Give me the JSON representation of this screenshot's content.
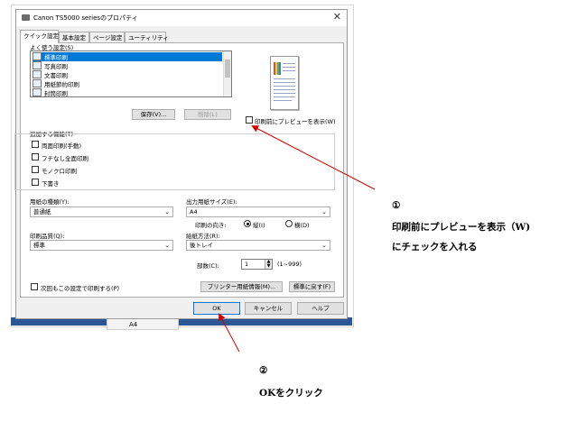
{
  "window": {
    "title": "Canon TS5000 seriesのプロパティ",
    "close_glyph": "✕"
  },
  "tabs": [
    "クイック設定",
    "基本設定",
    "ページ設定",
    "ユーティリティ"
  ],
  "favorites": {
    "label": "よく使う設定(S)",
    "items": [
      "標準印刷",
      "写真印刷",
      "文書印刷",
      "用紙節約印刷",
      "封筒印刷"
    ],
    "save_button": "保存(V)...",
    "delete_button": "削除(L)"
  },
  "preview_option": {
    "label": "印刷前にプレビューを表示(W)",
    "checked": false
  },
  "additional": {
    "label": "追加する機能(T)",
    "items": [
      "両面印刷(手動)",
      "フチなし全面印刷",
      "モノクロ印刷",
      "下書き"
    ]
  },
  "media_type": {
    "label": "用紙の種類(Y):",
    "value": "普通紙"
  },
  "print_quality": {
    "label": "印刷品質(Q):",
    "value": "標準"
  },
  "paper_size": {
    "label": "出力用紙サイズ(E):",
    "value": "A4"
  },
  "orientation": {
    "label": "印刷の向き:",
    "portrait": "縦(I)",
    "landscape": "横(D)",
    "selected": "portrait"
  },
  "paper_source": {
    "label": "給紙方法(R):",
    "value": "後トレイ"
  },
  "copies": {
    "label": "部数(C):",
    "value": "1",
    "range": "(1~999)"
  },
  "always_print": {
    "label": "次回もこの設定で印刷する(P)",
    "checked": false
  },
  "buttons": {
    "printer_media": "プリンター用紙情報(M)...",
    "defaults": "標準に戻す(F)",
    "ok": "OK",
    "cancel": "キャンセル",
    "help": "ヘルプ"
  },
  "background_row": "A4",
  "annotations": {
    "step1_number": "①",
    "step1_line1": "印刷前にプレビューを表示（W)",
    "step1_line2": "にチェックを入れる",
    "step2_number": "②",
    "step2_text": "OKをクリック"
  },
  "colors": {
    "selection": "#0078d7",
    "arrow": "#d40000",
    "window_bg": "#f0f0f0"
  }
}
